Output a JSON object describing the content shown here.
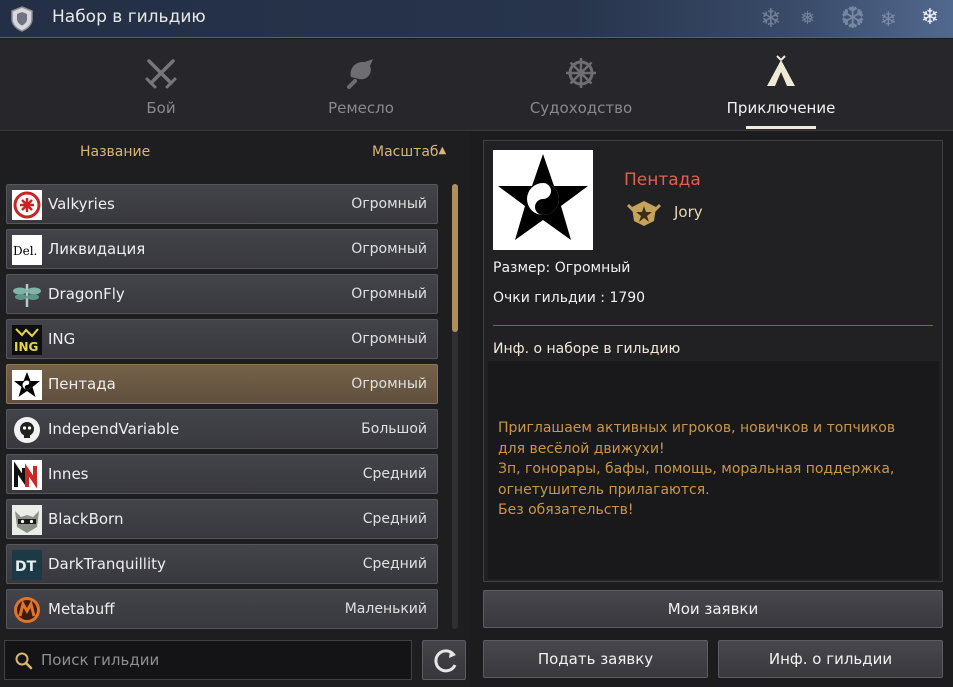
{
  "window": {
    "title": "Набор в гильдию",
    "close_icon": "snowflake-close-icon"
  },
  "tabs": [
    {
      "label": "Бой",
      "icon": "crossed-swords-icon",
      "active": false
    },
    {
      "label": "Ремесло",
      "icon": "craft-hammer-icon",
      "active": false
    },
    {
      "label": "Судоходство",
      "icon": "ship-wheel-icon",
      "active": false
    },
    {
      "label": "Приключение",
      "icon": "tent-icon",
      "active": true
    }
  ],
  "list": {
    "col_name": "Название",
    "col_scale": "Масштаб",
    "sort_indicator": "▲",
    "rows": [
      {
        "name": "Valkyries",
        "size": "Огромный",
        "emblem": "red-knot-emblem"
      },
      {
        "name": "Ликвидация",
        "size": "Огромный",
        "emblem": "del-text-emblem"
      },
      {
        "name": "DragonFly",
        "size": "Огромный",
        "emblem": "dragonfly-emblem"
      },
      {
        "name": "ING",
        "size": "Огромный",
        "emblem": "ing-emblem"
      },
      {
        "name": "Пентада",
        "size": "Огромный",
        "emblem": "pentagram-yinyang-emblem",
        "selected": true
      },
      {
        "name": "IndependVariable",
        "size": "Большой",
        "emblem": "skull-emblem"
      },
      {
        "name": "Innes",
        "size": "Средний",
        "emblem": "innes-emblem"
      },
      {
        "name": "BlackBorn",
        "size": "Средний",
        "emblem": "raccoon-emblem"
      },
      {
        "name": "DarkTranquillity",
        "size": "Средний",
        "emblem": "dt-emblem"
      },
      {
        "name": "Metabuff",
        "size": "Маленький",
        "emblem": "metabuff-emblem"
      }
    ]
  },
  "search": {
    "placeholder": "Поиск гильдии",
    "value": ""
  },
  "details": {
    "guild_name": "Пентада",
    "leader": "Jory",
    "size_line": "Размер: Огромный",
    "points_line": "Очки гильдии : 1790",
    "recruit_title": "Инф. о наборе в гильдию",
    "recruit_text": "Приглашаем активных игроков, новичков и топчиков\nдля весёлой движухи!\nЗп, гонорары, бафы, помощь, моральная поддержка,\nогнетушитель прилагаются.\nБез обязательств!"
  },
  "buttons": {
    "my_applications": "Мои заявки",
    "apply": "Подать заявку",
    "guild_info": "Инф. о гильдии"
  },
  "colors": {
    "accent_gold": "#d9b676",
    "guild_name": "#e2604d",
    "recruit_text": "#c9964a"
  }
}
